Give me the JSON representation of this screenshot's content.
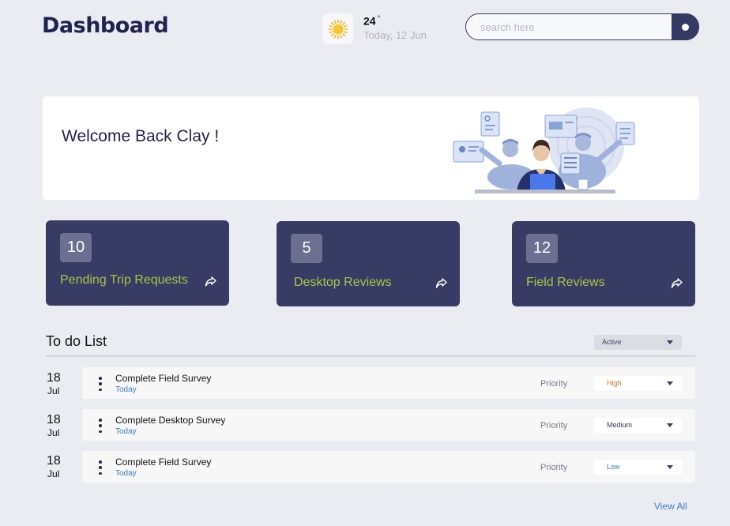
{
  "header": {
    "title": "Dashboard",
    "weather": {
      "icon": "sun-icon",
      "temperature": "24",
      "degree": "°",
      "date": "Today, 12 Jun"
    },
    "search": {
      "placeholder": "search here",
      "value": ""
    }
  },
  "welcome": {
    "message": "Welcome Back Clay !"
  },
  "stats": [
    {
      "count": "10",
      "label": "Pending Trip Requests",
      "icon": "share-icon"
    },
    {
      "count": "5",
      "label": "Desktop Reviews",
      "icon": "share-icon"
    },
    {
      "count": "12",
      "label": "Field Reviews",
      "icon": "share-icon"
    }
  ],
  "todo": {
    "title": "To do List",
    "filter": "Active",
    "priority_label": "Priority",
    "tasks": [
      {
        "day": "18",
        "month": "Jul",
        "name": "Complete Field Survey",
        "when": "Today",
        "priority": "High",
        "priority_color": "#e07b2f"
      },
      {
        "day": "18",
        "month": "Jul",
        "name": "Complete Desktop Survey",
        "when": "Today",
        "priority": "Medium",
        "priority_color": "#2b3a8a"
      },
      {
        "day": "18",
        "month": "Jul",
        "name": "Complete Field Survey",
        "when": "Today",
        "priority": "Low",
        "priority_color": "#3a7fd0"
      }
    ],
    "view_all": "View All"
  },
  "colors": {
    "primary": "#383b63",
    "accent": "#a8c545",
    "link": "#3a7fd0",
    "background": "#ebecf2"
  }
}
